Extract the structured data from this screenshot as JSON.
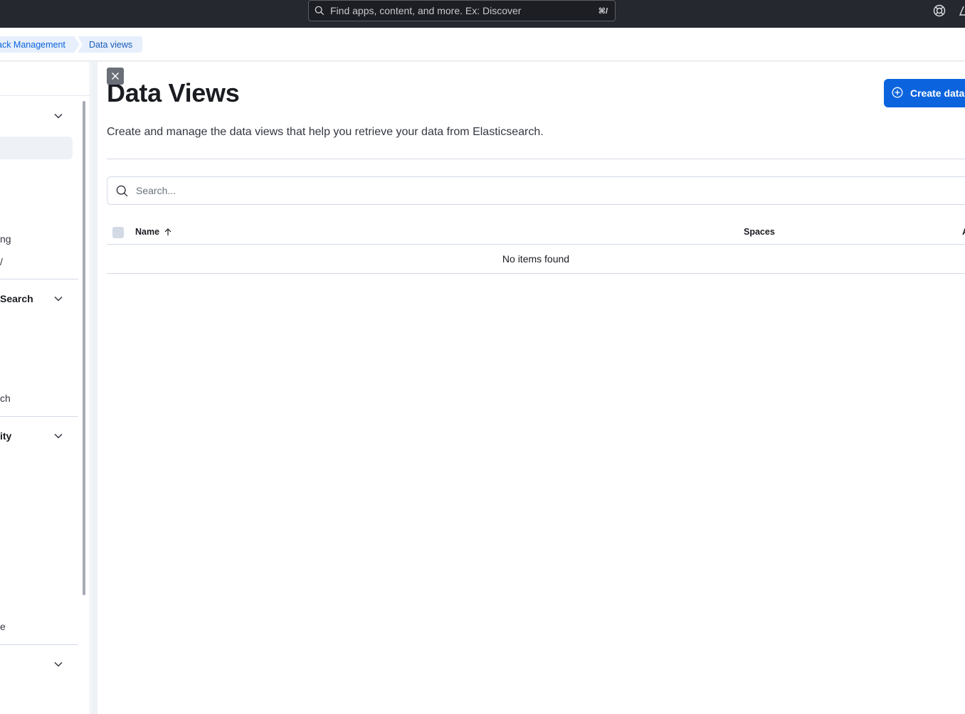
{
  "topbar": {
    "search_placeholder": "Find apps, content, and more. Ex: Discover",
    "search_shortcut": "⌘/"
  },
  "breadcrumbs": [
    {
      "label": "ack Management"
    },
    {
      "label": "Data views"
    }
  ],
  "sidebar": {
    "fragments": [
      {
        "text": "ng",
        "bold": false
      },
      {
        "text": "/",
        "bold": false
      },
      {
        "text": "Search",
        "bold": true
      },
      {
        "text": "ch",
        "bold": false
      },
      {
        "text": "ity",
        "bold": true
      },
      {
        "text": "e",
        "bold": false
      }
    ]
  },
  "main": {
    "title": "Data Views",
    "create_button": "Create data",
    "description": "Create and manage the data views that help you retrieve your data from Elasticsearch.",
    "search_placeholder": "Search...",
    "table": {
      "columns": [
        "Name",
        "Spaces",
        "A"
      ],
      "sort_column": "Name",
      "sort_direction": "ascending",
      "empty_message": "No items found"
    }
  },
  "colors": {
    "topbar_bg": "#25282f",
    "primary": "#0b64dd",
    "breadcrumb_bg": "#e6effb"
  }
}
